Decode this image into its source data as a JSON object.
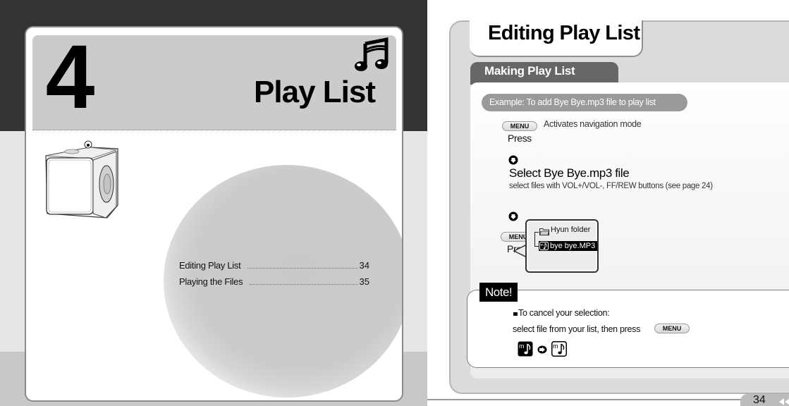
{
  "left_page": {
    "chapter_number": "4",
    "chapter_title": "Play List",
    "header_icon": "music-notes-icon",
    "illustration": "mp3-player-device",
    "toc": [
      {
        "label": "Editing Play List",
        "page": "34"
      },
      {
        "label": "Playing the Files",
        "page": "35"
      }
    ]
  },
  "right_page": {
    "title": "Editing Play List",
    "section": "Making Play List",
    "example": "Example: To add Bye Bye.mp3 file to play list",
    "steps": [
      {
        "key": "MENU",
        "action": "Press",
        "description": "Activates navigation mode"
      },
      {
        "title": "Select Bye Bye.mp3 file",
        "description": "select files with VOL+/VOL-, FF/REW buttons (see page 24)"
      },
      {
        "key": "MENU",
        "action": "Press"
      }
    ],
    "screen": {
      "folder_name": "Hyun folder",
      "selected_file": "bye bye.MP3"
    },
    "note": {
      "label": "Note!",
      "line1": "To cancel your selection:",
      "line2": "select file from your list, then press",
      "key": "MENU",
      "icons": [
        "file-selected-icon",
        "arrow-right-icon",
        "file-unselected-icon"
      ]
    },
    "page_number": "34",
    "colors": {
      "dark_band": "#333333",
      "header_gray": "#cbcbcb",
      "section_tab": "#666666",
      "example_pill": "#9a9a9a"
    }
  }
}
